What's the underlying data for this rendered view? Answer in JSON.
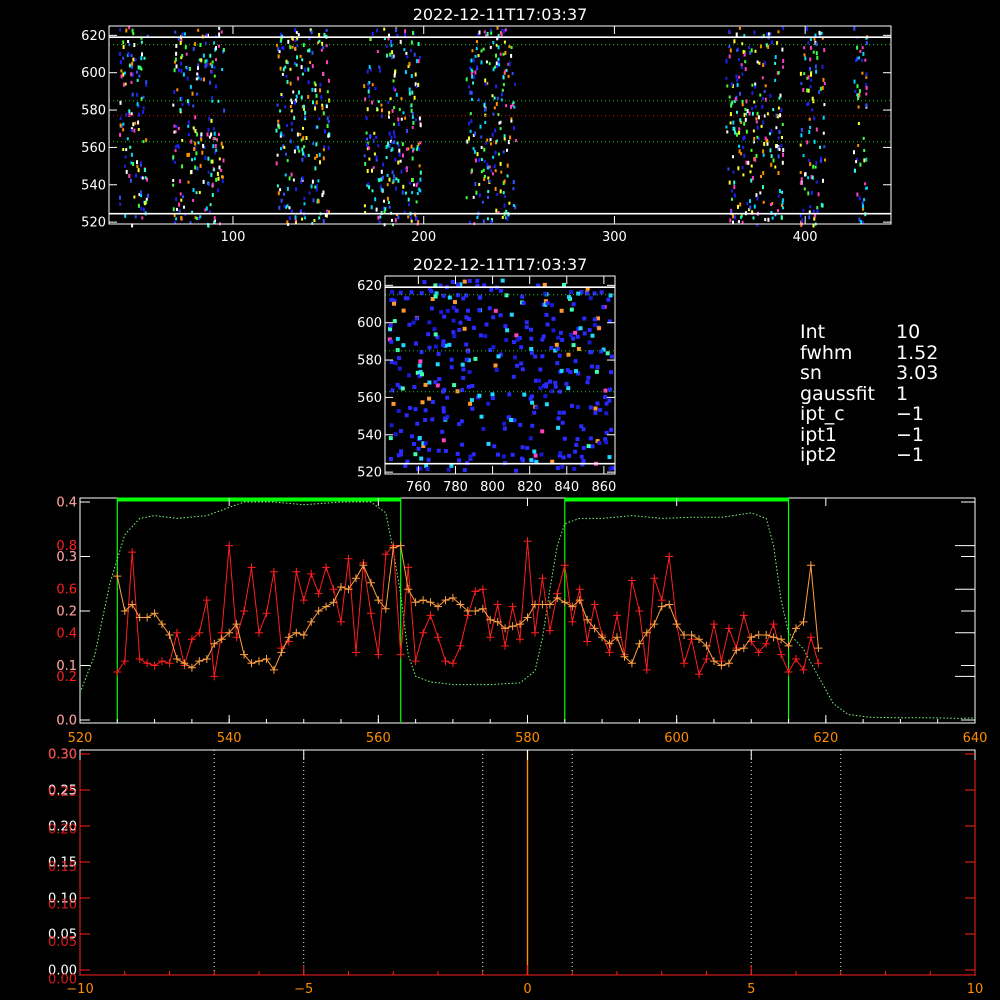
{
  "colors": {
    "background": "#000000",
    "axis": "#ffffff",
    "red_axis": "#ff2020",
    "orange_axis": "#ff8c00",
    "green_guide": "#19c819",
    "green_bar": "#00ff00",
    "red_guide": "#d01010",
    "red_series": "#ff1e1e",
    "orange_series": "#ffa040"
  },
  "params": [
    {
      "name": "Int",
      "value": "10"
    },
    {
      "name": "fwhm",
      "value": "1.52"
    },
    {
      "name": "sn",
      "value": "3.03"
    },
    {
      "name": "gaussfit",
      "value": "1"
    },
    {
      "name": "ipt_c",
      "value": "−1"
    },
    {
      "name": "ipt1",
      "value": "−1"
    },
    {
      "name": "ipt2",
      "value": "−1"
    }
  ],
  "chart_data": [
    {
      "id": "top-image",
      "type": "heatmap",
      "title": "2022-12-11T17:03:37",
      "xlim": [
        35,
        445
      ],
      "ylim": [
        519,
        625
      ],
      "xticks": [
        100,
        200,
        300,
        400
      ],
      "yticks": [
        520,
        540,
        560,
        580,
        600,
        620
      ],
      "bright_columns": [
        [
          40,
          55
        ],
        [
          68,
          95
        ],
        [
          122,
          150
        ],
        [
          168,
          198
        ],
        [
          222,
          248
        ],
        [
          358,
          388
        ],
        [
          397,
          410
        ],
        [
          425,
          432
        ]
      ],
      "hlines_green": [
        563,
        585,
        615
      ],
      "hline_red": 577,
      "hlines_white": [
        524.5,
        619
      ]
    },
    {
      "id": "zoom-image",
      "type": "heatmap",
      "title": "2022-12-11T17:03:37",
      "xlim": [
        742,
        866
      ],
      "ylim": [
        519,
        625
      ],
      "xticks": [
        760,
        780,
        800,
        820,
        840,
        860
      ],
      "yticks": [
        520,
        540,
        560,
        580,
        600,
        620
      ],
      "hlines_green": [
        563,
        585,
        615
      ],
      "hlines_white": [
        524.5,
        619
      ]
    },
    {
      "id": "profile",
      "type": "line",
      "xlim": [
        520,
        640
      ],
      "xticks": [
        520,
        540,
        560,
        580,
        600,
        620,
        640
      ],
      "ylim_white": [
        0.0,
        0.4
      ],
      "yticks_white": [
        0.0,
        0.1,
        0.2,
        0.3,
        0.4
      ],
      "ylim_red": [
        0.0,
        1.0
      ],
      "yticks_red": [
        0.2,
        0.4,
        0.6,
        0.8
      ],
      "green_windows": [
        [
          525,
          563
        ],
        [
          585,
          615
        ]
      ],
      "green_profile": {
        "x": [
          520,
          522,
          524,
          526,
          528,
          530,
          533,
          537,
          542,
          546,
          550,
          555,
          559,
          561,
          562,
          563,
          564,
          565,
          567,
          570,
          575,
          579,
          581,
          582,
          583,
          584,
          585,
          587,
          590,
          594,
          598,
          602,
          606,
          610,
          612,
          613,
          614,
          615,
          617,
          619,
          621,
          623,
          626,
          630,
          634,
          638,
          640
        ],
        "y": [
          0.05,
          0.12,
          0.25,
          0.34,
          0.37,
          0.375,
          0.37,
          0.375,
          0.4,
          0.4,
          0.395,
          0.4,
          0.4,
          0.38,
          0.31,
          0.23,
          0.12,
          0.08,
          0.07,
          0.065,
          0.065,
          0.068,
          0.09,
          0.15,
          0.24,
          0.32,
          0.36,
          0.37,
          0.37,
          0.375,
          0.37,
          0.372,
          0.372,
          0.38,
          0.37,
          0.32,
          0.22,
          0.16,
          0.13,
          0.08,
          0.03,
          0.01,
          0.005,
          0.004,
          0.004,
          0.003,
          0.004
        ]
      },
      "series": [
        {
          "axis": "red",
          "x": [
            525,
            526,
            527,
            528,
            529,
            530,
            531,
            532,
            533,
            534,
            535,
            536,
            537,
            538,
            539,
            540,
            541,
            542,
            543,
            544,
            545,
            546,
            547,
            548,
            549,
            550,
            551,
            552,
            553,
            554,
            555,
            556,
            557,
            558,
            559,
            560,
            561,
            562,
            563,
            564,
            565,
            566,
            567,
            568,
            569,
            570,
            571,
            572,
            573,
            574,
            575,
            576,
            577,
            578,
            579,
            580,
            581,
            582,
            583,
            584,
            585,
            586,
            587,
            588,
            589,
            590,
            591,
            592,
            593,
            594,
            595,
            596,
            597,
            598,
            599,
            600,
            601,
            602,
            603,
            604,
            605,
            606,
            607,
            608,
            609,
            610,
            611,
            612,
            613,
            614,
            615,
            616,
            617,
            618,
            619
          ],
          "y": [
            0.22,
            0.27,
            0.77,
            0.28,
            0.26,
            0.25,
            0.27,
            0.26,
            0.4,
            0.25,
            0.37,
            0.4,
            0.55,
            0.2,
            0.4,
            0.8,
            0.38,
            0.5,
            0.7,
            0.4,
            0.49,
            0.68,
            0.33,
            0.36,
            0.68,
            0.55,
            0.67,
            0.58,
            0.7,
            0.6,
            0.45,
            0.74,
            0.31,
            0.72,
            0.49,
            0.3,
            0.76,
            0.8,
            0.3,
            0.7,
            0.27,
            0.4,
            0.48,
            0.38,
            0.27,
            0.26,
            0.34,
            0.48,
            0.59,
            0.6,
            0.38,
            0.53,
            0.34,
            0.52,
            0.37,
            0.82,
            0.4,
            0.65,
            0.41,
            0.58,
            0.71,
            0.45,
            0.6,
            0.36,
            0.53,
            0.39,
            0.31,
            0.48,
            0.3,
            0.64,
            0.5,
            0.23,
            0.65,
            0.55,
            0.75,
            0.44,
            0.26,
            0.37,
            0.21,
            0.28,
            0.44,
            0.27,
            0.42,
            0.33,
            0.48,
            0.36,
            0.31,
            0.35,
            0.44,
            0.3,
            0.22,
            0.28,
            0.23,
            0.38,
            0.26
          ]
        },
        {
          "axis": "red",
          "x": [
            525,
            526,
            527,
            528,
            529,
            530,
            531,
            532,
            533,
            534,
            535,
            536,
            537,
            538,
            539,
            540,
            541,
            542,
            543,
            544,
            545,
            546,
            547,
            548,
            549,
            550,
            551,
            552,
            553,
            554,
            555,
            556,
            557,
            558,
            559,
            560,
            561,
            562,
            563,
            564,
            565,
            566,
            567,
            568,
            569,
            570,
            571,
            572,
            573,
            574,
            575,
            576,
            577,
            578,
            579,
            580,
            581,
            582,
            583,
            584,
            585,
            586,
            587,
            588,
            589,
            590,
            591,
            592,
            593,
            594,
            595,
            596,
            597,
            598,
            599,
            600,
            601,
            602,
            603,
            604,
            605,
            606,
            607,
            608,
            609,
            610,
            611,
            612,
            613,
            614,
            615,
            616,
            617,
            618,
            619
          ],
          "y": [
            0.66,
            0.5,
            0.53,
            0.47,
            0.47,
            0.49,
            0.44,
            0.39,
            0.28,
            0.26,
            0.24,
            0.27,
            0.28,
            0.35,
            0.37,
            0.4,
            0.44,
            0.3,
            0.26,
            0.27,
            0.28,
            0.23,
            0.31,
            0.38,
            0.4,
            0.39,
            0.45,
            0.5,
            0.52,
            0.54,
            0.61,
            0.6,
            0.65,
            0.71,
            0.63,
            0.55,
            0.51,
            0.79,
            0.8,
            0.6,
            0.54,
            0.55,
            0.54,
            0.52,
            0.55,
            0.56,
            0.53,
            0.5,
            0.5,
            0.51,
            0.46,
            0.45,
            0.42,
            0.43,
            0.44,
            0.47,
            0.53,
            0.53,
            0.53,
            0.56,
            0.54,
            0.52,
            0.55,
            0.46,
            0.42,
            0.38,
            0.35,
            0.38,
            0.29,
            0.26,
            0.35,
            0.4,
            0.44,
            0.52,
            0.53,
            0.44,
            0.39,
            0.39,
            0.37,
            0.34,
            0.27,
            0.25,
            0.26,
            0.32,
            0.33,
            0.38,
            0.39,
            0.39,
            0.38,
            0.37,
            0.34,
            0.42,
            0.45,
            0.71,
            0.33
          ]
        }
      ]
    },
    {
      "id": "spectrum",
      "type": "line",
      "xlim": [
        -10,
        10
      ],
      "xticks": [
        -10,
        -5,
        0,
        5,
        10
      ],
      "ylim": [
        0.0,
        0.3
      ],
      "yticks_white": [
        0.0,
        0.05,
        0.1,
        0.15,
        0.2,
        0.25,
        0.3
      ],
      "yticks_orange": [
        0.0,
        0.05,
        0.1,
        0.15,
        0.2,
        0.25,
        0.3
      ],
      "vlines_dotted": [
        -7,
        -5,
        -1,
        1,
        5,
        7
      ],
      "vline_center": 0
    }
  ]
}
